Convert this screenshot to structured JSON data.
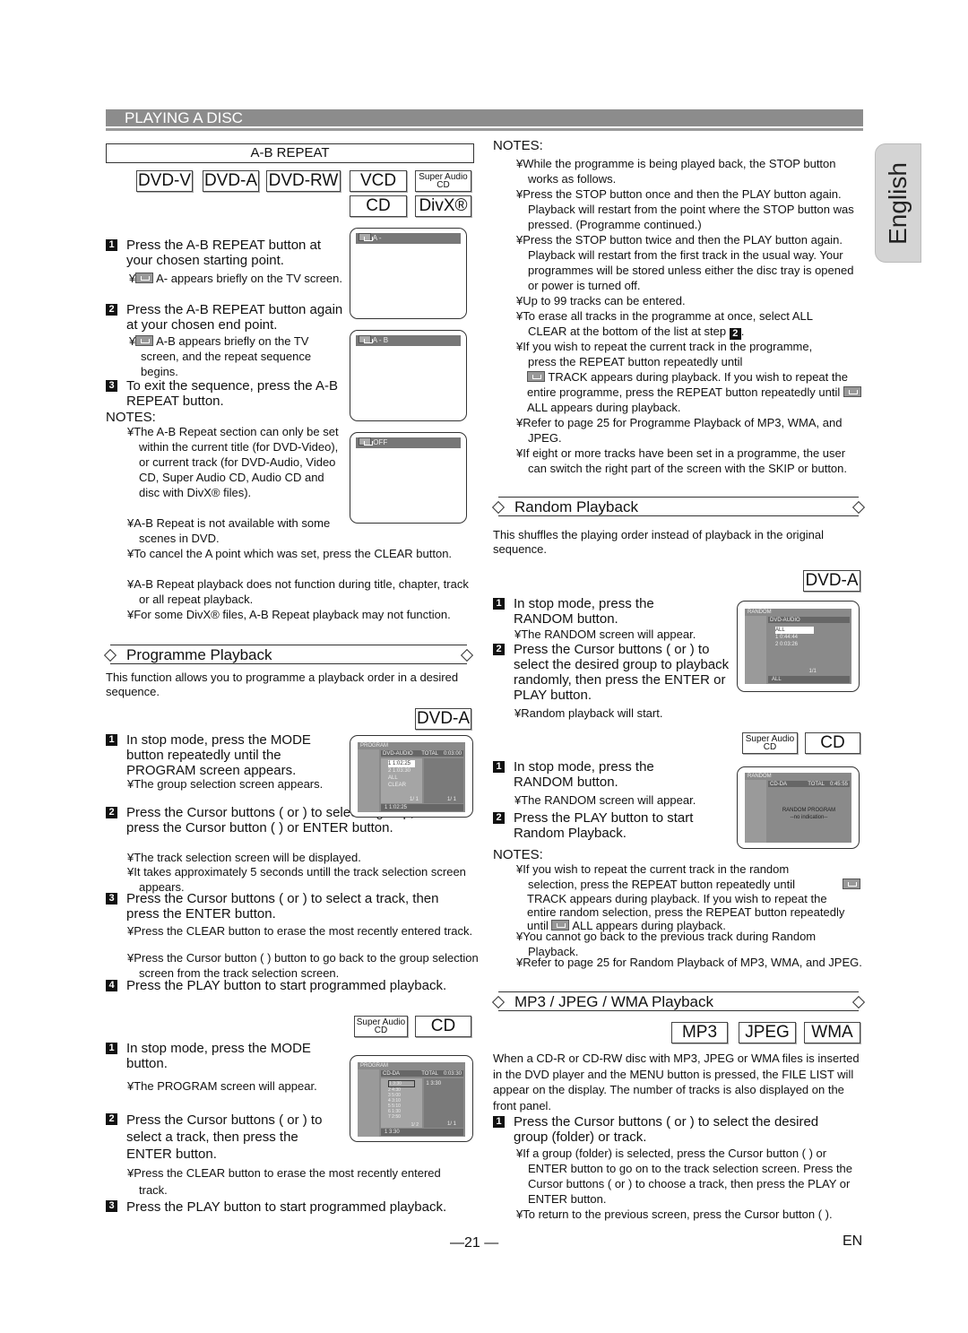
{
  "header": {
    "title": "PLAYING A DISC",
    "language_tab": "English"
  },
  "ab_repeat": {
    "title": "A-B REPEAT",
    "badges": [
      "DVD-V",
      "DVD-A",
      "DVD-RW",
      "VCD",
      "Super Audio CD",
      "CD",
      "DivX®"
    ],
    "steps": [
      {
        "num": "1",
        "text": "Press the A-B REPEAT button at your chosen starting point.",
        "note": "A- appears briefly on the TV screen."
      },
      {
        "num": "2",
        "text": "Press the A-B REPEAT button again at your chosen end point.",
        "note": "A-B appears briefly on the TV screen, and the repeat sequence begins."
      },
      {
        "num": "3",
        "text": "To exit the sequence, press the A-B REPEAT button."
      }
    ],
    "screens": [
      "A -",
      "A - B",
      "OFF"
    ],
    "notes_heading": "NOTES:",
    "notes": [
      "¥The A-B Repeat section can only be set within the current title (for DVD-Video), or current track (for DVD-Audio, Video CD, Super Audio CD, Audio CD and disc with DivX® files).",
      "¥A-B Repeat is not available with some scenes in DVD.",
      "¥To cancel the A point which was set, press the CLEAR button.",
      "¥A-B Repeat playback does not function during title, chapter, track or all repeat playback.",
      "¥For some DivX® files, A-B Repeat playback may not function."
    ]
  },
  "programme": {
    "title": "Programme Playback",
    "description": "This function allows you to programme a playback order in a desired sequence.",
    "dvd_badge": "DVD-A",
    "dvd_steps": [
      {
        "num": "1",
        "text": "In stop mode, press the MODE button repeatedly until the PROGRAM screen appears.",
        "notes": [
          "¥The group selection screen appears."
        ]
      },
      {
        "num": "2",
        "text": "Press the Cursor  buttons (    or    ) to select a group, then press the Cursor  button (   ) or ENTER button.",
        "notes": [
          "¥The track selection screen will be displayed.",
          "¥It takes approximately 5 seconds untill the track selection screen appears."
        ]
      },
      {
        "num": "3",
        "text": "Press the Cursor  buttons (    or    ) to select a track, then press the ENTER button.",
        "notes": [
          "¥Press the CLEAR button to erase the most recently entered track.",
          "¥Press the Cursor  button (   ) button to go back to the group selection screen from the track selection screen."
        ]
      },
      {
        "num": "4",
        "text": "Press the PLAY button to start programmed playback."
      }
    ],
    "dvd_screen": {
      "title": "PROGRAM",
      "source": "DVD-AUDIO",
      "total_label": "TOTAL",
      "total": "0:03:00",
      "items": [
        "1  1:02:25",
        "2  1:03:30",
        "ALL CLEAR"
      ],
      "page_left": "1/ 1",
      "page_right": "1/ 1",
      "footer": "1  1:02:25"
    },
    "cd_badges": [
      "Super Audio CD",
      "CD"
    ],
    "cd_steps": [
      {
        "num": "1",
        "text": "In stop mode, press the MODE button.",
        "notes": [
          "¥The PROGRAM screen will appear."
        ]
      },
      {
        "num": "2",
        "text": "Press the Cursor  buttons (    or    ) to select a track, then press the ENTER button.",
        "notes": [
          "¥Press the CLEAR button to erase the most recently entered track."
        ]
      },
      {
        "num": "3",
        "text": "Press the PLAY button to start programmed playback."
      }
    ],
    "cd_screen": {
      "title": "PROGRAM",
      "source": "CD-DA",
      "total_label": "TOTAL",
      "total": "0:03:30",
      "items": [
        "1  3:30",
        "2  4:30",
        "3  5:00",
        "4  3:10",
        "5  5:10",
        "6  1:30",
        "7  2:50"
      ],
      "page_left": "1/ 2",
      "right_item": "1  3:30",
      "page_right": "1/ 1",
      "footer": "1  3:30"
    }
  },
  "programme_notes": {
    "heading": "NOTES:",
    "items": [
      "¥While the programme is being played back, the STOP button works as follows.",
      "¥Press the STOP button once and then the PLAY button again. Playback will restart from the point where the STOP button was pressed. (Programme continued.)",
      "¥Press the STOP button twice and then the PLAY button again. Playback will restart from the first track in the usual way. Your programmes will be stored unless either the disc tray is opened or power is turned off.",
      "¥Up to 99 tracks can be entered.",
      "¥To erase all tracks in the programme at once, select ALL CLEAR at the bottom of the list at step",
      "¥If you wish to repeat the current track in the programme, press the REPEAT button repeatedly until",
      "TRACK appears during playback. If you wish to repeat the entire programme, press the REPEAT button repeatedly until",
      "ALL appears during playback.",
      "¥Refer to page 25 for Programme Playback of MP3, WMA, and JPEG.",
      "¥If eight or more tracks have been set in a programme, the user can switch the right part of the screen with the SKIP       or       button."
    ],
    "step_ref": "2"
  },
  "random": {
    "title": "Random Playback",
    "description": "This shuffles the playing order instead of playback in the original sequence.",
    "dvd_badge": "DVD-A",
    "dvd_steps": [
      {
        "num": "1",
        "text": "In stop mode, press the RANDOM button.",
        "notes": [
          "¥The RANDOM screen will appear."
        ]
      },
      {
        "num": "2",
        "text": "Press the Cursor  buttons (    or    ) to select the desired group to playback randomly, then press the ENTER or PLAY button.",
        "notes": [
          "¥Random playback will start."
        ]
      }
    ],
    "dvd_screen": {
      "title": "RANDOM",
      "source": "DVD-AUDIO",
      "items": [
        "ALL",
        "1  0:44:44",
        "2  0:03:26"
      ],
      "page": "1/1",
      "footer": "ALL"
    },
    "cd_badges": [
      "Super Audio CD",
      "CD"
    ],
    "cd_steps": [
      {
        "num": "1",
        "text": "In stop mode, press the RANDOM button.",
        "notes": [
          "¥The RANDOM screen will appear."
        ]
      },
      {
        "num": "2",
        "text": "Press the PLAY button to start Random Playback."
      }
    ],
    "cd_screen": {
      "title": "RANDOM",
      "source": "CD-DA",
      "total_label": "TOTAL",
      "total": "0:45:55",
      "message": "RANDOM PROGRAM",
      "sub": "--no indication--"
    },
    "notes_heading": "NOTES:",
    "notes": [
      "¥If you wish to repeat the current track in the random selection, press the REPEAT button repeatedly until",
      "TRACK appears during playback. If you wish to repeat the entire random selection, press the REPEAT button repeatedly until",
      "ALL appears during playback.",
      "¥You cannot go back to the previous track during Random Playback.",
      "¥Refer to page 25 for Random Playback of MP3, WMA, and JPEG."
    ]
  },
  "mp3": {
    "title": "MP3 / JPEG / WMA Playback",
    "badges": [
      "MP3",
      "JPEG",
      "WMA"
    ],
    "description": "When a CD-R or CD-RW disc with MP3, JPEG or WMA files is inserted in the DVD player and the MENU button is pressed, the FILE LIST will appear on the display. The number of tracks is also displayed on the front panel.",
    "steps": [
      {
        "num": "1",
        "text": "Press the Cursor  buttons (    or    ) to select the desired group (folder) or track.",
        "notes": [
          "¥If a group (folder) is selected, press the Cursor  button (   ) or ENTER button to go on to the track selection screen.  Press the Cursor  buttons (    or    ) to choose a track, then press the PLAY or ENTER button.",
          "¥To return to the previous screen, press the Cursor button (   )."
        ]
      }
    ]
  },
  "footer": {
    "page_number": "—21 —",
    "lang": "EN"
  }
}
